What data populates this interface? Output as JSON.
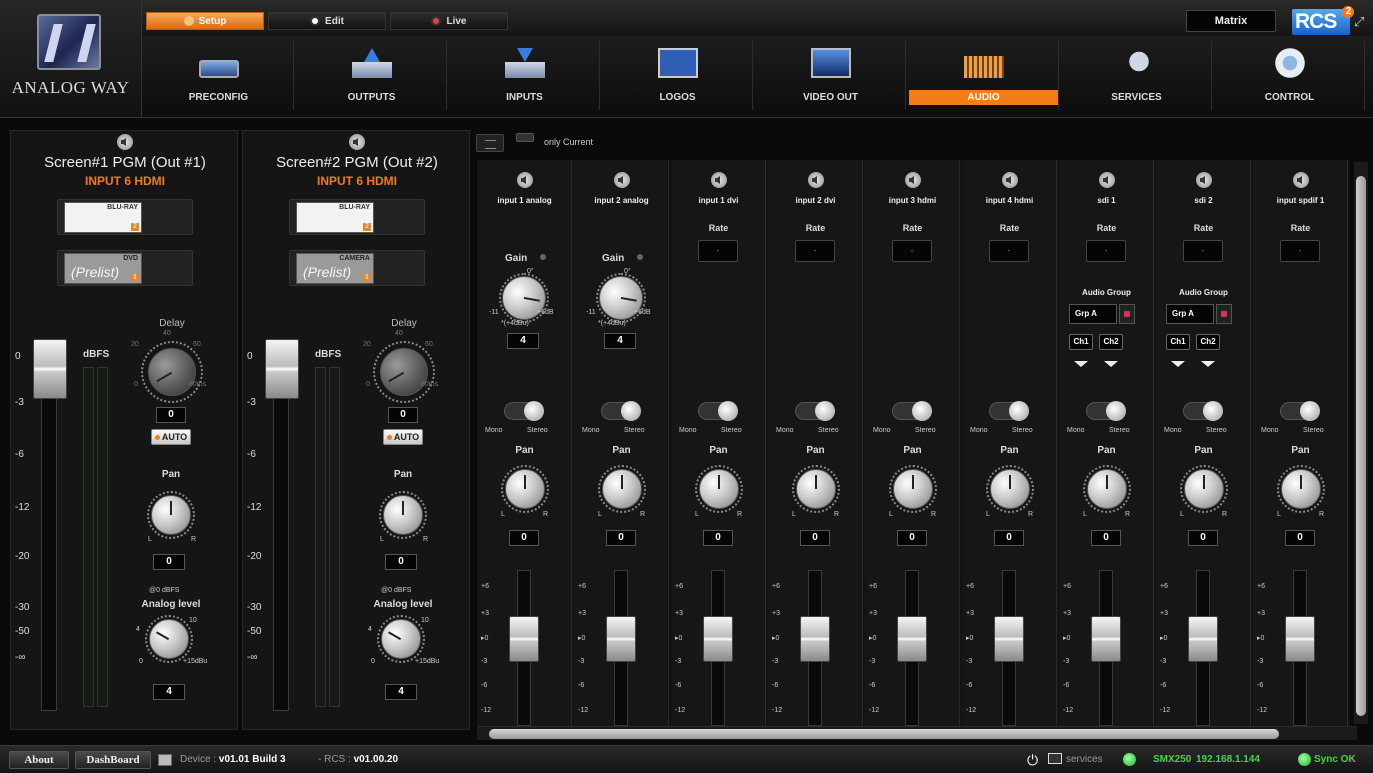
{
  "brand": {
    "logo_text": "ANALOG WAY",
    "rcs_text": "RCS",
    "rcs_sup": "2"
  },
  "modes": [
    {
      "label": "Setup",
      "active": true,
      "dot": ""
    },
    {
      "label": "Edit",
      "active": false,
      "dot": "#ffffff"
    },
    {
      "label": "Live",
      "active": false,
      "dot": "#e84040"
    }
  ],
  "matrix_label": "Matrix",
  "nav": [
    {
      "label": "PRECONFIG",
      "icon": "preconfig-icon",
      "active": false
    },
    {
      "label": "OUTPUTS",
      "icon": "outputs-icon",
      "active": false
    },
    {
      "label": "INPUTS",
      "icon": "inputs-icon",
      "active": false
    },
    {
      "label": "LOGOS",
      "icon": "logos-icon",
      "active": false
    },
    {
      "label": "VIDEO OUT",
      "icon": "video-out-icon",
      "active": false
    },
    {
      "label": "AUDIO",
      "icon": "audio-icon",
      "active": true
    },
    {
      "label": "SERVICES",
      "icon": "services-icon",
      "active": false
    },
    {
      "label": "CONTROL",
      "icon": "control-icon",
      "active": false
    }
  ],
  "screens": [
    {
      "title": "Screen#1 PGM (Out #1)",
      "source": "INPUT 6 HDMI",
      "preview1": {
        "label": "BLU-RAY",
        "number": "2"
      },
      "preview2": {
        "label": "DVD",
        "sub": "(Prelist)",
        "number": "1"
      },
      "dbfs_label": "dBFS",
      "scale": [
        "0",
        "-3",
        "-6",
        "-12",
        "-20",
        "-30",
        "-50",
        "-∞"
      ],
      "delay_label": "Delay",
      "delay_marks": [
        "20",
        "40",
        "60",
        "0",
        "80ms"
      ],
      "delay_value": "0",
      "auto_label": "AUTO",
      "pan_label": "Pan",
      "pan_l": "L",
      "pan_r": "R",
      "pan_value": "0",
      "ref_label": "@0 dBFS",
      "analog_label": "Analog level",
      "analog_marks": [
        "4",
        "10",
        "0",
        "+15dBu"
      ],
      "analog_value": "4"
    },
    {
      "title": "Screen#2 PGM (Out #2)",
      "source": "INPUT 6 HDMI",
      "preview1": {
        "label": "BLU-RAY",
        "number": "2"
      },
      "preview2": {
        "label": "CAMERA",
        "sub": "(Prelist)",
        "number": "1"
      },
      "dbfs_label": "dBFS",
      "scale": [
        "0",
        "-3",
        "-6",
        "-12",
        "-20",
        "-30",
        "-50",
        "-∞"
      ],
      "delay_label": "Delay",
      "delay_marks": [
        "20",
        "40",
        "60",
        "0",
        "80ms"
      ],
      "delay_value": "0",
      "auto_label": "AUTO",
      "pan_label": "Pan",
      "pan_l": "L",
      "pan_r": "R",
      "pan_value": "0",
      "ref_label": "@0 dBFS",
      "analog_label": "Analog level",
      "analog_marks": [
        "4",
        "10",
        "0",
        "+15dBu"
      ],
      "analog_value": "4"
    }
  ],
  "mixer": {
    "only_current_label": "only Current",
    "gain_label": "Gain",
    "gain_marks": [
      "0°",
      "-11",
      "+6dB",
      "*(+4dBu)"
    ],
    "rate_label": "Rate",
    "rate_value": "-",
    "audio_group_label": "Audio Group",
    "group_value": "Grp A",
    "ch1_label": "Ch1",
    "ch2_label": "Ch2",
    "mono_label": "Mono",
    "stereo_label": "Stereo",
    "pan_label": "Pan",
    "pan_l": "L",
    "pan_r": "R",
    "fader_scale": [
      "+6",
      "+3",
      "▸0",
      "-3",
      "-6",
      "-12"
    ],
    "channels": [
      {
        "name": "input 1 analog",
        "kind": "analog",
        "gain_value": "4",
        "pan_value": "0"
      },
      {
        "name": "input 2 analog",
        "kind": "analog",
        "gain_value": "4",
        "pan_value": "0"
      },
      {
        "name": "input 1 dvi",
        "kind": "digital",
        "pan_value": "0"
      },
      {
        "name": "input 2 dvi",
        "kind": "digital",
        "pan_value": "0"
      },
      {
        "name": "input 3 hdmi",
        "kind": "digital",
        "pan_value": "0"
      },
      {
        "name": "input 4 hdmi",
        "kind": "digital",
        "pan_value": "0"
      },
      {
        "name": "sdi 1",
        "kind": "sdi",
        "pan_value": "0"
      },
      {
        "name": "sdi 2",
        "kind": "sdi",
        "pan_value": "0"
      },
      {
        "name": "input spdif 1",
        "kind": "digital",
        "pan_value": "0"
      }
    ]
  },
  "status": {
    "about_label": "About",
    "dashboard_label": "DashBoard",
    "device_label": "Device :",
    "device_value": "v01.01 Build 3",
    "rcs_label": "- RCS :",
    "rcs_value": "v01.00.20",
    "services_label": "services",
    "device_name": "SMX250",
    "ip": "192.168.1.144",
    "sync_label": "Sync OK"
  }
}
